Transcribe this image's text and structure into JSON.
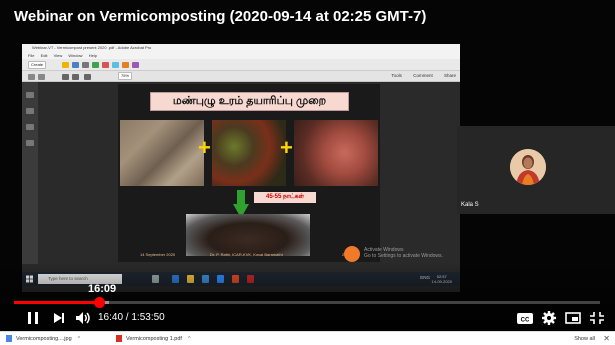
{
  "video": {
    "title": "Webinar on Vermicomposting (2020-09-14 at 02:25 GMT-7)"
  },
  "app": {
    "title": "Webinar-VT - Vermicompost present 2020 .pdf - Adobe Acrobat Pro",
    "menu": [
      "File",
      "Edit",
      "View",
      "Window",
      "Help"
    ],
    "toolbar_create": "Create",
    "zoom": "75%",
    "right_tabs": [
      "Tools",
      "Comment",
      "Share"
    ]
  },
  "slide": {
    "title": "மண்புழு உரம் தயாரிப்பு முறை",
    "plus_symbol": "+",
    "days_label": "45-55 நாட்கள்",
    "footer_date": "14 September 2020",
    "footer_author": "Dr. P. Rathi, ICAR-KVK, Kovai Baramathi",
    "footer_page": "20",
    "watermark_line1": "Activate Windows",
    "watermark_line2": "Go to Settings to activate Windows."
  },
  "windows_taskbar": {
    "search_placeholder": "Type here to search",
    "tray_lang": "ENG",
    "clock_time": "02:57",
    "clock_date": "14-09-2020"
  },
  "participant": {
    "name": "Kala S"
  },
  "player": {
    "hover_time": "16:09",
    "time_display": "16:40 / 1:53:50",
    "progress": {
      "played_fraction": 0.1465,
      "loaded_fraction": 0.162
    }
  },
  "downloads": {
    "items": [
      {
        "name": "Vermicomposting....jpg",
        "icon": "image-file-icon"
      },
      {
        "name": "Vermicomposting 1.pdf",
        "icon": "pdf-file-icon"
      }
    ],
    "show_all": "Show all",
    "close": "✕"
  },
  "colors": {
    "progress_red": "#ff0000",
    "slide_title_bg": "#f7d9d1",
    "plus_yellow": "#ffd400",
    "arrow_green": "#2fa12f"
  }
}
